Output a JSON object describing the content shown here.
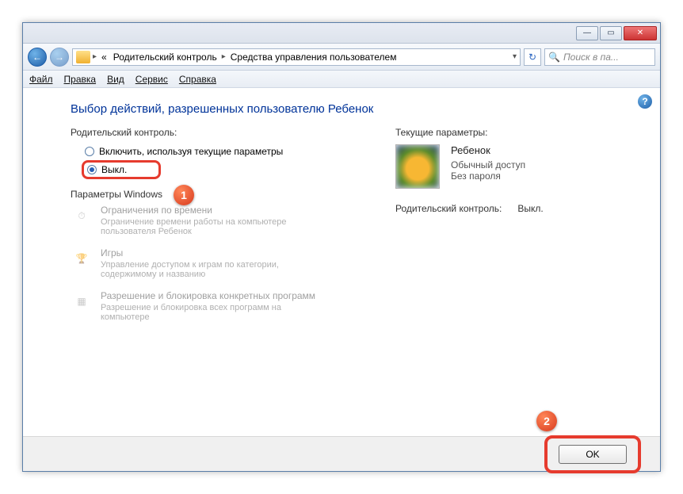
{
  "titlebar": {
    "minimize": "—",
    "maximize": "▭",
    "close": "✕"
  },
  "nav": {
    "prefix": "«",
    "crumb1": "Родительский контроль",
    "crumb2": "Средства управления пользователем",
    "search_placeholder": "Поиск в па..."
  },
  "menu": {
    "file": "Файл",
    "edit": "Правка",
    "view": "Вид",
    "tools": "Сервис",
    "help": "Справка"
  },
  "page": {
    "heading": "Выбор действий, разрешенных пользователю Ребенок",
    "pc_label": "Родительский контроль:",
    "radio_on": "Включить, используя текущие параметры",
    "radio_off": "Выкл.",
    "win_params": "Параметры Windows",
    "s1_title": "Ограничения по времени",
    "s1_desc": "Ограничение времени работы на компьютере пользователя Ребенок",
    "s2_title": "Игры",
    "s2_desc": "Управление доступом к играм по категории, содержимому и названию",
    "s3_title": "Разрешение и блокировка конкретных программ",
    "s3_desc": "Разрешение и блокировка всех программ на компьютере",
    "cur_params": "Текущие параметры:",
    "user_name": "Ребенок",
    "user_type": "Обычный доступ",
    "user_pw": "Без пароля",
    "status_label": "Родительский контроль:",
    "status_value": "Выкл."
  },
  "footer": {
    "ok": "OK"
  },
  "callouts": {
    "one": "1",
    "two": "2"
  }
}
